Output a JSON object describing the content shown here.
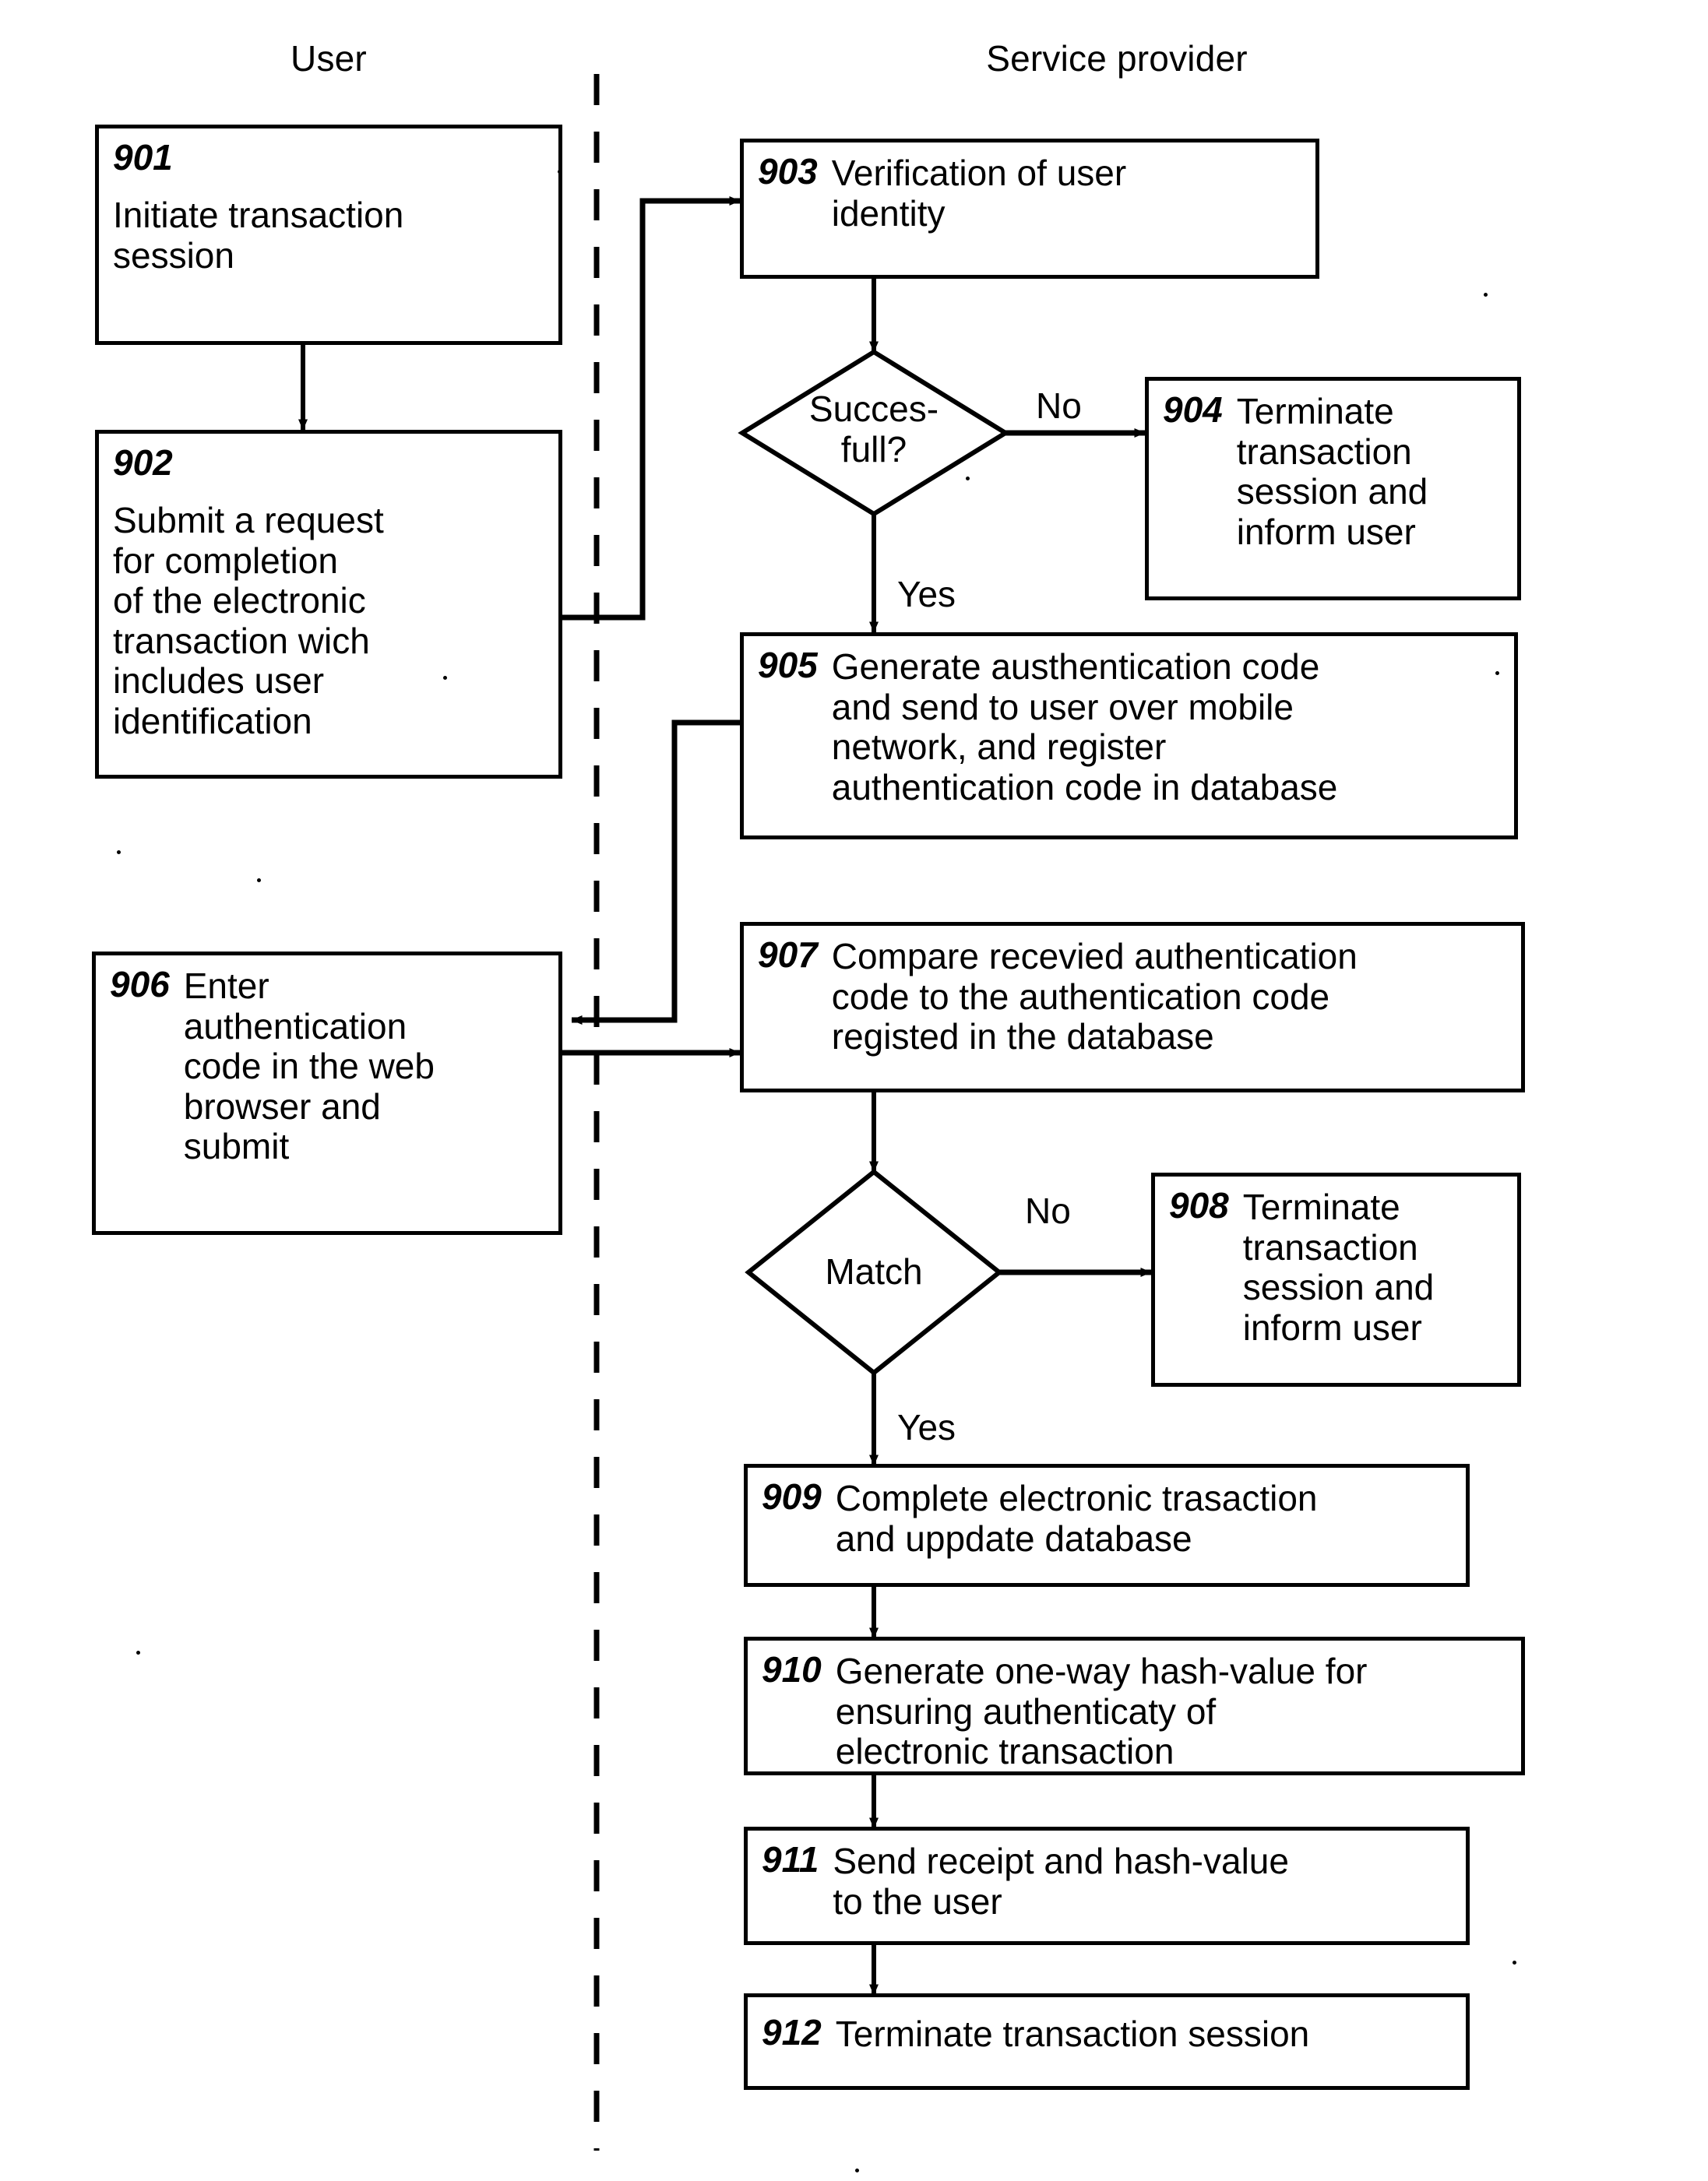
{
  "diagram": {
    "type": "flowchart",
    "title": "Electronic transaction authentication flowchart",
    "lanes": [
      {
        "id": "user",
        "label": "User"
      },
      {
        "id": "service_provider",
        "label": "Service provider"
      }
    ],
    "divider": {
      "style": "dashed",
      "orientation": "vertical"
    }
  },
  "nodes": {
    "n901": {
      "num": "901",
      "text": "Initiate transaction\nsession",
      "shape": "rect",
      "lane": "user"
    },
    "n902": {
      "num": "902",
      "text": "Submit a request\nfor completion\nof the electronic\ntransaction wich\nincludes user\nidentification",
      "shape": "rect",
      "lane": "user"
    },
    "n903": {
      "num": "903",
      "text": "Verification of user\nidentity",
      "shape": "rect",
      "lane": "service_provider"
    },
    "d904": {
      "num": "",
      "text": "Succes-\nfull?",
      "shape": "diamond",
      "lane": "service_provider"
    },
    "n904": {
      "num": "904",
      "text": "Terminate\ntransaction\nsession and\ninform user",
      "shape": "rect",
      "lane": "service_provider"
    },
    "n905": {
      "num": "905",
      "text": "Generate austhentication code\nand send to user over mobile\nnetwork, and register\nauthentication code in database",
      "shape": "rect",
      "lane": "service_provider"
    },
    "n906": {
      "num": "906",
      "text": "Enter\nauthentication\ncode in the web\nbrowser and\nsubmit",
      "shape": "rect",
      "lane": "user"
    },
    "n907": {
      "num": "907",
      "text": "Compare recevied  authentication\ncode to the authentication code\nregisted in the database",
      "shape": "rect",
      "lane": "service_provider"
    },
    "dmatch": {
      "num": "",
      "text": "Match",
      "shape": "diamond",
      "lane": "service_provider"
    },
    "n908": {
      "num": "908",
      "text": "Terminate\ntransaction\nsession and\ninform user",
      "shape": "rect",
      "lane": "service_provider"
    },
    "n909": {
      "num": "909",
      "text": "Complete electronic trasaction\nand uppdate database",
      "shape": "rect",
      "lane": "service_provider"
    },
    "n910": {
      "num": "910",
      "text": "Generate one-way hash-value for\nensuring authenticaty of\nelectronic transaction",
      "shape": "rect",
      "lane": "service_provider"
    },
    "n911": {
      "num": "911",
      "text": "Send receipt and hash-value\nto the user",
      "shape": "rect",
      "lane": "service_provider"
    },
    "n912": {
      "num": "912",
      "text": "Terminate transaction session",
      "shape": "rect",
      "lane": "service_provider"
    }
  },
  "edge_labels": {
    "no_1": "No",
    "yes_1": "Yes",
    "no_2": "No",
    "yes_2": "Yes"
  },
  "colors": {
    "stroke": "#000000",
    "background": "#ffffff"
  }
}
